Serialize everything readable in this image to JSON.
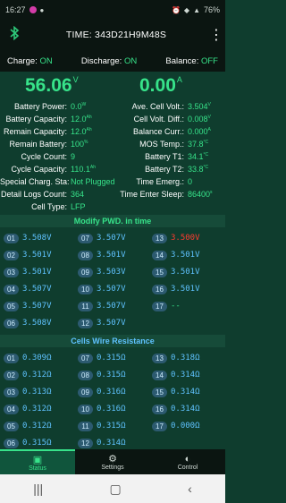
{
  "status_bar": {
    "time": "16:27",
    "right_text": "76%"
  },
  "header": {
    "title": "TIME: 343D21H9M48S"
  },
  "switches": {
    "charge_label": "Charge:",
    "charge_value": "ON",
    "discharge_label": "Discharge:",
    "discharge_value": "ON",
    "balance_label": "Balance:",
    "balance_value": "OFF"
  },
  "summary": {
    "voltage": "56.06",
    "voltage_unit": "V",
    "current": "0.00",
    "current_unit": "A"
  },
  "left_params": [
    {
      "k": "Battery Power:",
      "v": "0.0",
      "u": "W"
    },
    {
      "k": "Battery Capacity:",
      "v": "12.0",
      "u": "Ah"
    },
    {
      "k": "Remain Capacity:",
      "v": "12.0",
      "u": "Ah"
    },
    {
      "k": "Remain Battery:",
      "v": "100",
      "u": "%"
    },
    {
      "k": "Cycle Count:",
      "v": "9",
      "u": ""
    },
    {
      "k": "Cycle Capacity:",
      "v": "110.1",
      "u": "Ah"
    },
    {
      "k": "Special Charg. Sta:",
      "v": "Not Plugged",
      "u": ""
    },
    {
      "k": "Detail Logs Count:",
      "v": "364",
      "u": ""
    },
    {
      "k": "Cell Type:",
      "v": "LFP",
      "u": ""
    }
  ],
  "right_params": [
    {
      "k": "Ave. Cell Volt.:",
      "v": "3.504",
      "u": "V"
    },
    {
      "k": "Cell Volt. Diff.:",
      "v": "0.008",
      "u": "V"
    },
    {
      "k": "Balance Curr.:",
      "v": "0.000",
      "u": "A"
    },
    {
      "k": "MOS Temp.:",
      "v": "37.8",
      "u": "°C"
    },
    {
      "k": "Battery T1:",
      "v": "34.1",
      "u": "°C"
    },
    {
      "k": "Battery T2:",
      "v": "33.8",
      "u": "°C"
    },
    {
      "k": "Time Emerg.:",
      "v": "0",
      "u": ""
    },
    {
      "k": "Time Enter Sleep:",
      "v": "86400",
      "u": "s"
    }
  ],
  "cells_voltage_title": "Modify PWD. in time",
  "cells_voltage": [
    {
      "idx": "01",
      "v": "3.508",
      "u": "V"
    },
    {
      "idx": "07",
      "v": "3.507",
      "u": "V"
    },
    {
      "idx": "13",
      "v": "3.500",
      "u": "V"
    },
    {
      "idx": "02",
      "v": "3.501",
      "u": "V"
    },
    {
      "idx": "08",
      "v": "3.501",
      "u": "V"
    },
    {
      "idx": "14",
      "v": "3.501",
      "u": "V"
    },
    {
      "idx": "03",
      "v": "3.501",
      "u": "V"
    },
    {
      "idx": "09",
      "v": "3.503",
      "u": "V"
    },
    {
      "idx": "15",
      "v": "3.501",
      "u": "V"
    },
    {
      "idx": "04",
      "v": "3.507",
      "u": "V"
    },
    {
      "idx": "10",
      "v": "3.507",
      "u": "V"
    },
    {
      "idx": "16",
      "v": "3.501",
      "u": "V"
    },
    {
      "idx": "05",
      "v": "3.507",
      "u": "V"
    },
    {
      "idx": "11",
      "v": "3.507",
      "u": "V"
    },
    {
      "idx": "17",
      "v": "--",
      "u": ""
    },
    {
      "idx": "06",
      "v": "3.508",
      "u": "V"
    },
    {
      "idx": "12",
      "v": "3.507",
      "u": "V"
    }
  ],
  "cells_resistance_title": "Cells Wire Resistance",
  "cells_resistance": [
    {
      "idx": "01",
      "v": "0.309",
      "u": "Ω"
    },
    {
      "idx": "07",
      "v": "0.315",
      "u": "Ω"
    },
    {
      "idx": "13",
      "v": "0.318",
      "u": "Ω"
    },
    {
      "idx": "02",
      "v": "0.312",
      "u": "Ω"
    },
    {
      "idx": "08",
      "v": "0.315",
      "u": "Ω"
    },
    {
      "idx": "14",
      "v": "0.314",
      "u": "Ω"
    },
    {
      "idx": "03",
      "v": "0.313",
      "u": "Ω"
    },
    {
      "idx": "09",
      "v": "0.316",
      "u": "Ω"
    },
    {
      "idx": "15",
      "v": "0.314",
      "u": "Ω"
    },
    {
      "idx": "04",
      "v": "0.312",
      "u": "Ω"
    },
    {
      "idx": "10",
      "v": "0.316",
      "u": "Ω"
    },
    {
      "idx": "16",
      "v": "0.314",
      "u": "Ω"
    },
    {
      "idx": "05",
      "v": "0.312",
      "u": "Ω"
    },
    {
      "idx": "11",
      "v": "0.315",
      "u": "Ω"
    },
    {
      "idx": "17",
      "v": "0.000",
      "u": "Ω"
    },
    {
      "idx": "06",
      "v": "0.315",
      "u": "Ω"
    },
    {
      "idx": "12",
      "v": "0.314",
      "u": "Ω"
    }
  ],
  "nav": {
    "status": "Status",
    "settings": "Settings",
    "control": "Control"
  },
  "colors": {
    "accent_green": "#37e38a",
    "value_blue": "#5fc2ff",
    "alert_red": "#ff3b30",
    "background": "#0f3d2e"
  }
}
